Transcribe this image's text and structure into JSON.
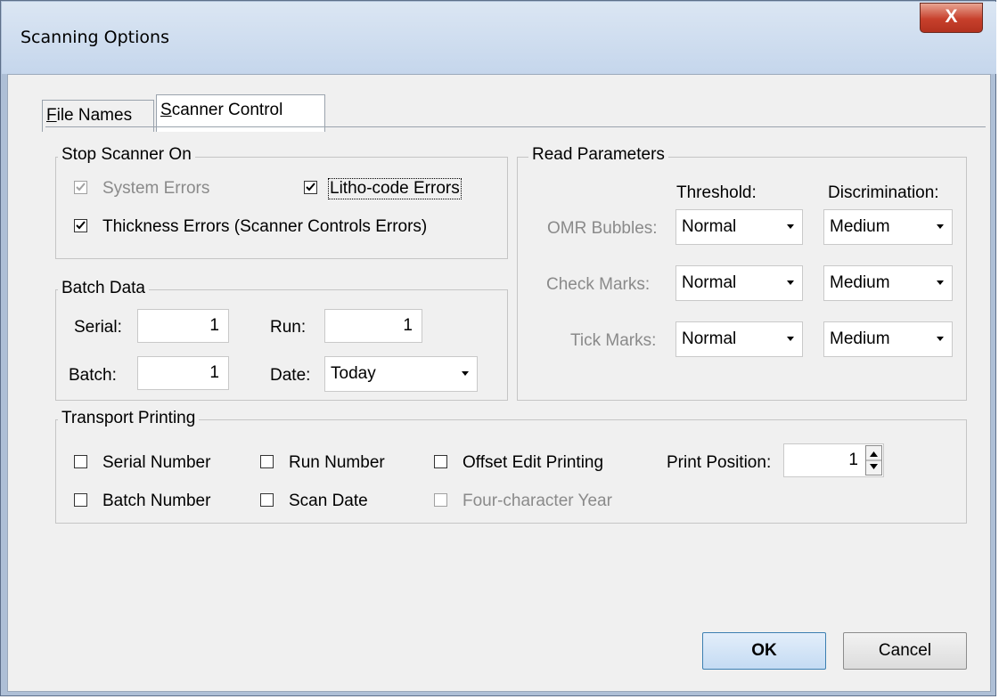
{
  "window": {
    "title": "Scanning Options",
    "close_label": "X"
  },
  "tabs": [
    {
      "label": "File Names",
      "accel": "F",
      "rest": "ile Names"
    },
    {
      "label": "Scanner Control",
      "accel": "S",
      "rest": "canner Control"
    }
  ],
  "stop_scanner": {
    "title": "Stop Scanner On",
    "system_errors": {
      "label": "System Errors",
      "checked": true,
      "enabled": false
    },
    "litho_errors": {
      "label": "Litho-code Errors",
      "checked": true,
      "enabled": true
    },
    "thickness_errors": {
      "label": "Thickness Errors (Scanner Controls Errors)",
      "checked": true,
      "enabled": true
    }
  },
  "batch_data": {
    "title": "Batch Data",
    "serial_label": "Serial:",
    "serial_value": "1",
    "run_label": "Run:",
    "run_value": "1",
    "batch_label": "Batch:",
    "batch_value": "1",
    "date_label": "Date:",
    "date_value": "Today"
  },
  "read_parameters": {
    "title": "Read Parameters",
    "threshold_header": "Threshold:",
    "discrimination_header": "Discrimination:",
    "rows": [
      {
        "label": "OMR Bubbles:",
        "threshold": "Normal",
        "discrimination": "Medium"
      },
      {
        "label": "Check Marks:",
        "threshold": "Normal",
        "discrimination": "Medium"
      },
      {
        "label": "Tick Marks:",
        "threshold": "Normal",
        "discrimination": "Medium"
      }
    ]
  },
  "transport_printing": {
    "title": "Transport Printing",
    "serial_number": "Serial Number",
    "batch_number": "Batch Number",
    "run_number": "Run Number",
    "scan_date": "Scan Date",
    "offset_edit": "Offset Edit Printing",
    "four_char_year": "Four-character Year",
    "print_position_label": "Print Position:",
    "print_position_value": "1"
  },
  "buttons": {
    "ok": "OK",
    "cancel": "Cancel"
  }
}
